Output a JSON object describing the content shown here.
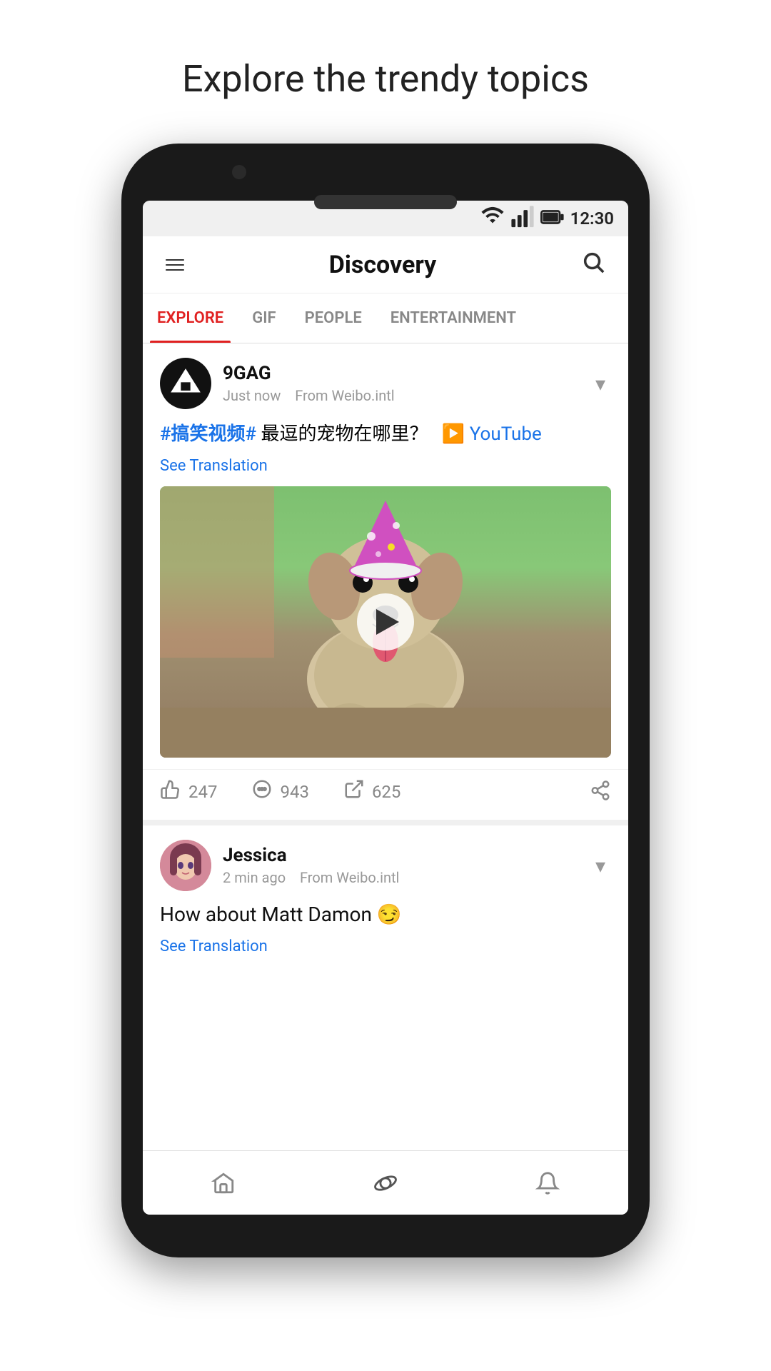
{
  "page": {
    "title": "Explore the trendy topics"
  },
  "statusBar": {
    "time": "12:30",
    "icons": [
      "wifi",
      "signal",
      "battery"
    ]
  },
  "header": {
    "title": "Discovery",
    "menuLabel": "Menu",
    "searchLabel": "Search"
  },
  "tabs": [
    {
      "id": "explore",
      "label": "EXPLORE",
      "active": true
    },
    {
      "id": "gif",
      "label": "GIF",
      "active": false
    },
    {
      "id": "people",
      "label": "PEOPLE",
      "active": false
    },
    {
      "id": "entertainment",
      "label": "ENTERTAINMENT",
      "active": false
    }
  ],
  "posts": [
    {
      "id": "post-1",
      "username": "9GAG",
      "time": "Just now",
      "source": "From Weibo.intl",
      "hashtag": "#搞笑视频#",
      "text": " 最逗的宠物在哪里？",
      "youtubeLabel": "YouTube",
      "seeTranslation": "See Translation",
      "likes": "247",
      "comments": "943",
      "reposts": "625"
    },
    {
      "id": "post-2",
      "username": "Jessica",
      "time": "2 min ago",
      "source": "From Weibo.intl",
      "text": "How about Matt Damon 😏",
      "seeTranslation": "See Translation"
    }
  ],
  "bottomNav": [
    {
      "id": "home",
      "icon": "home",
      "label": "Home"
    },
    {
      "id": "discover",
      "icon": "planet",
      "label": "Discover",
      "active": true
    },
    {
      "id": "notifications",
      "icon": "bell",
      "label": "Notifications"
    }
  ]
}
